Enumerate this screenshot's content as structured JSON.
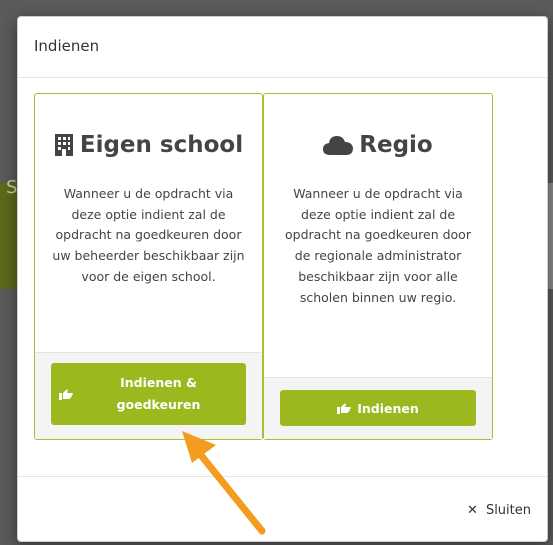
{
  "modal": {
    "title": "Indienen",
    "close_label": "Sluiten"
  },
  "cards": [
    {
      "heading": "Eigen school",
      "icon": "building-icon",
      "description": "Wanneer u de opdracht via deze optie indient zal de opdracht na goedkeuren door uw beheerder beschikbaar zijn voor de eigen school.",
      "button_label": "Indienen & goedkeuren"
    },
    {
      "heading": "Regio",
      "icon": "cloud-icon",
      "description": "Wanneer u de opdracht via deze optie indient zal de opdracht na goedkeuren door de regionale administrator beschikbaar zijn voor alle scholen binnen uw regio.",
      "button_label": "Indienen"
    }
  ],
  "background": {
    "partial_letter": "S"
  },
  "colors": {
    "accent": "#9cb81f",
    "card_border": "#a6c12a",
    "annotation_arrow": "#f39c1f"
  }
}
